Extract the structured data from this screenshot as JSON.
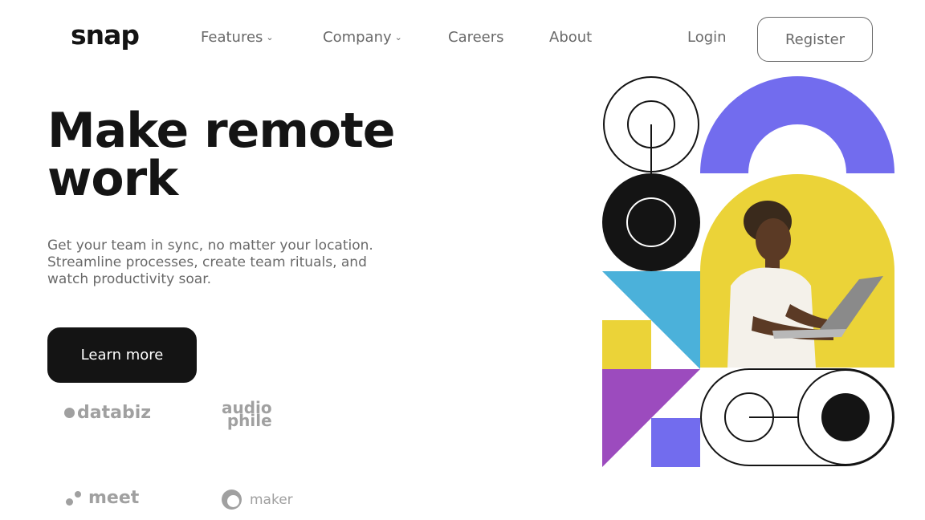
{
  "brand": {
    "logo": "snap"
  },
  "nav": {
    "items": [
      {
        "label": "Features",
        "has_dropdown": true,
        "chevron": "chevron-down-icon"
      },
      {
        "label": "Company",
        "has_dropdown": true,
        "chevron": "chevron-down-icon"
      },
      {
        "label": "Careers",
        "has_dropdown": false
      },
      {
        "label": "About",
        "has_dropdown": false
      }
    ],
    "login": "Login",
    "register": "Register"
  },
  "hero": {
    "headline_line1": "Make remote",
    "headline_line2": "work",
    "subtext_line1": "Get your team in sync, no matter your location.",
    "subtext_line2": "Streamline processes, create team rituals, and",
    "subtext_line3": "watch productivity soar.",
    "cta": "Learn more",
    "image": "person-with-laptop"
  },
  "clients": [
    {
      "name": "databiz",
      "icon": "databiz-logo"
    },
    {
      "name_line1": "audio",
      "name_line2": "phile",
      "icon": "audiophile-logo"
    },
    {
      "name": "meet",
      "icon": "meet-logo"
    },
    {
      "name": "maker",
      "icon": "maker-logo"
    }
  ],
  "colors": {
    "text_dark": "#141414",
    "text_gray": "#696969",
    "logo_gray": "#a0a0a0",
    "accent_purple": "#726CEE",
    "accent_yellow": "#EBD338",
    "accent_blue": "#4BB1DA",
    "accent_violet": "#9C4BBE"
  }
}
